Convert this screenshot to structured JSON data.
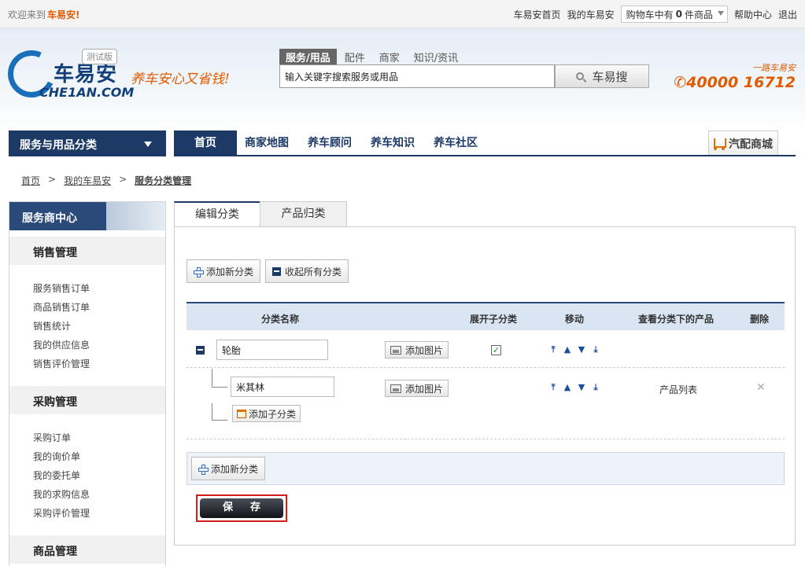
{
  "topbar": {
    "welcome": "欢迎来到",
    "brand": "车易安!",
    "links": {
      "home": "车易安首页",
      "mine": "我的车易安",
      "cart_prefix": "购物车中有",
      "cart_count": "0",
      "cart_suffix": "件商品",
      "help": "帮助中心",
      "logout": "退出"
    }
  },
  "header": {
    "logo_cn": "车易安",
    "logo_en": "CHE1AN.COM",
    "beta": "测试版",
    "slogan": "养车安心又省钱!",
    "search_tabs": [
      "服务/用品",
      "配件",
      "商家",
      "知识/资讯"
    ],
    "search_placeholder": "输入关键字搜索服务或用品",
    "search_button": "车易搜",
    "hotline_tag": "一路车易安",
    "hotline_number": "40000 16712"
  },
  "nav": {
    "category": "服务与用品分类",
    "items": [
      "首页",
      "商家地图",
      "养车顾问",
      "养车知识",
      "养车社区"
    ],
    "mall": "汽配商城"
  },
  "breadcrumb": {
    "home": "首页",
    "mine": "我的车易安",
    "current": "服务分类管理",
    "sep": ">"
  },
  "sidebar": {
    "head": "服务商中心",
    "sections": [
      {
        "title": "销售管理",
        "items": [
          "服务销售订单",
          "商品销售订单",
          "销售统计",
          "我的供应信息",
          "销售评价管理"
        ]
      },
      {
        "title": "采购管理",
        "items": [
          "采购订单",
          "我的询价单",
          "我的委托单",
          "我的求购信息",
          "采购评价管理"
        ]
      },
      {
        "title": "商品管理",
        "items": []
      }
    ]
  },
  "main": {
    "tabs": [
      "编辑分类",
      "产品归类"
    ],
    "add_category": "添加新分类",
    "collapse_all": "收起所有分类",
    "columns": [
      "分类名称",
      "展开子分类",
      "移动",
      "查看分类下的产品",
      "删除"
    ],
    "rows": [
      {
        "name": "轮胎",
        "add_image": "添加图片",
        "expanded": true
      },
      {
        "name": "米其林",
        "add_image": "添加图片",
        "product_list": "产品列表"
      }
    ],
    "add_subcategory": "添加子分类",
    "add_category_bottom": "添加新分类",
    "save": "保存"
  },
  "colors": {
    "navy": "#1d3a66",
    "accent": "#e05a00",
    "save_border": "#d41c1c"
  }
}
